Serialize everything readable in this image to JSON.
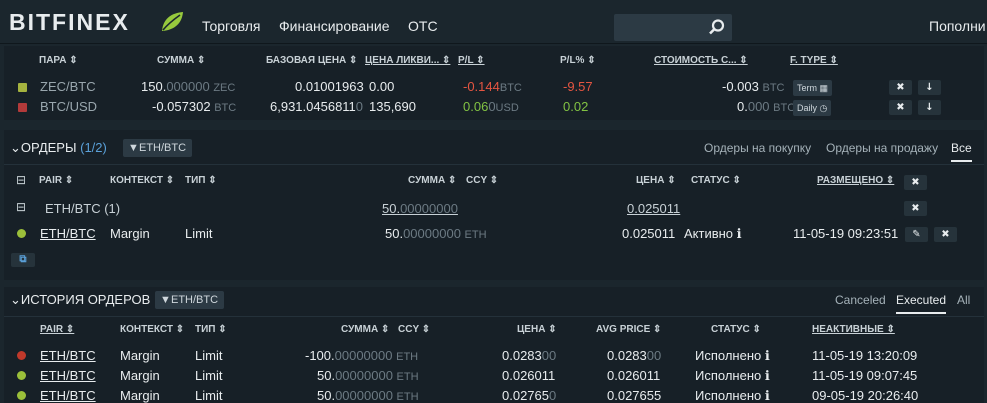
{
  "nav": {
    "logo": "BITFINEX",
    "links": [
      "Торговля",
      "Финансирование",
      "OTC"
    ],
    "fund": "Пополни"
  },
  "positions": {
    "headers": [
      "ПАРА ⇕",
      "СУММА ⇕",
      "БАЗОВАЯ ЦЕНА ⇕",
      "ЦЕНА ЛИКВИ... ⇕",
      "P/L ⇕",
      "P/L% ⇕",
      "СТОИМОСТЬ С... ⇕",
      "F. TYPE ⇕"
    ],
    "rows": [
      {
        "pair": "ZEC/BTC",
        "amount": "150.",
        "amount_dim": "000000",
        "amount_ccy": "ZEC",
        "base": "0.01001963",
        "liq": "0.00",
        "pl": "-0.144",
        "pl_ccy": "BTC",
        "plpct": "-9.57",
        "cost": "-0.003",
        "cost_ccy": "BTC",
        "ftype": "Term",
        "color": "#a5b33f",
        "pl_color": "#e55541",
        "plpct_color": "#e55541"
      },
      {
        "pair": "BTC/USD",
        "amount": "-0.057302",
        "amount_dim": "",
        "amount_ccy": "BTC",
        "base": "6,931.0456811",
        "base_dim": "0",
        "liq": "135,690",
        "pl": "0.06",
        "pl_dim": "0",
        "pl_ccy": "USD",
        "plpct": "0.02",
        "cost": "0.",
        "cost_dim": "000",
        "cost_ccy": "BTC",
        "ftype": "Daily",
        "color": "#b33a3a",
        "pl_color": "#82c243",
        "plpct_color": "#82c243"
      }
    ]
  },
  "orders": {
    "title": "ОРДЕРЫ",
    "count": "(1/2)",
    "filter": "ETH/BTC",
    "tabs": [
      "Ордеры на покупку",
      "Ордеры на продажу",
      "Все"
    ],
    "headers": {
      "pair": "PAIR ⇕",
      "ctx": "КОНТЕКСТ ⇕",
      "type": "ТИП ⇕",
      "amt": "СУММА ⇕",
      "ccy": "CCY ⇕",
      "price": "ЦЕНА ⇕",
      "status": "СТАТУС ⇕",
      "placed": "РАЗМЕЩЕНО ⇕"
    },
    "group": {
      "label": "ETH/BTC (1)",
      "amount": "50.",
      "amount_dim": "00000000",
      "price": "0.025011"
    },
    "row": {
      "pair": "ETH/BTC",
      "ctx": "Margin",
      "type": "Limit",
      "amount": "50.",
      "amount_dim": "00000000",
      "ccy": "ETH",
      "price": "0.025011",
      "status": "Активно",
      "placed": "11-05-19 09:23:51"
    }
  },
  "history": {
    "title": "ИСТОРИЯ ОРДЕРОВ",
    "filter": "ETH/BTC",
    "tabs": [
      "Canceled",
      "Executed",
      "All"
    ],
    "headers": {
      "pair": "PAIR ⇕",
      "ctx": "КОНТЕКСТ ⇕",
      "type": "ТИП ⇕",
      "amt": "СУММА ⇕",
      "ccy": "CCY ⇕",
      "price": "ЦЕНА ⇕",
      "avg": "AVG PRICE ⇕",
      "status": "СТАТУС ⇕",
      "inactive": "НЕАКТИВНЫЕ ⇕"
    },
    "rows": [
      {
        "pair": "ETH/BTC",
        "ctx": "Margin",
        "type": "Limit",
        "amount": "-100.",
        "amount_dim": "00000000",
        "ccy": "ETH",
        "price": "0.0283",
        "price_dim": "00",
        "avg": "0.0283",
        "avg_dim": "00",
        "status": "Исполнено",
        "time": "11-05-19 13:20:09",
        "color": "#c0392b"
      },
      {
        "pair": "ETH/BTC",
        "ctx": "Margin",
        "type": "Limit",
        "amount": "50.",
        "amount_dim": "00000000",
        "ccy": "ETH",
        "price": "0.026011",
        "price_dim": "",
        "avg": "0.026011",
        "avg_dim": "",
        "status": "Исполнено",
        "time": "11-05-19 09:07:45",
        "color": "#9bbf3a"
      },
      {
        "pair": "ETH/BTC",
        "ctx": "Margin",
        "type": "Limit",
        "amount": "50.",
        "amount_dim": "00000000",
        "ccy": "ETH",
        "price": "0.02765",
        "price_dim": "0",
        "avg": "0.027655",
        "avg_dim": "",
        "status": "Исполнено",
        "time": "09-05-19 20:26:40",
        "color": "#9bbf3a"
      }
    ]
  },
  "colors": {
    "bg": "#1b262d",
    "panel": "#172027",
    "red": "#e55541",
    "green": "#82c243"
  }
}
